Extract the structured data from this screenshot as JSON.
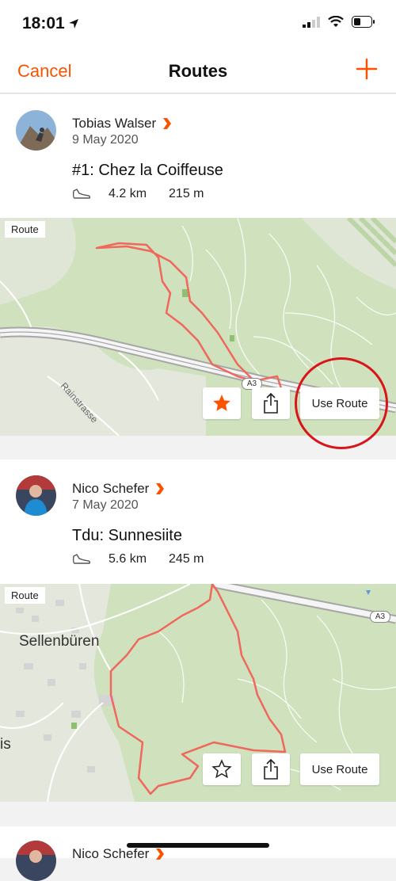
{
  "status_bar": {
    "time": "18:01"
  },
  "nav": {
    "cancel": "Cancel",
    "title": "Routes"
  },
  "routes": [
    {
      "athlete": "Tobias Walser",
      "date": "9 May 2020",
      "title": "#1: Chez la Coiffeuse",
      "distance": "4.2 km",
      "elevation": "215 m",
      "map_label": "Route",
      "street_label": "Rainstrasse",
      "highway_label": "A3",
      "starred": true,
      "use_route": "Use Route"
    },
    {
      "athlete": "Nico Schefer",
      "date": "7 May 2020",
      "title": "Tdu: Sunnesiite",
      "distance": "5.6 km",
      "elevation": "245 m",
      "map_label": "Route",
      "town_label": "Sellenbüren",
      "town_partial": "is",
      "highway_label": "A3",
      "starred": false,
      "use_route": "Use Route"
    },
    {
      "athlete": "Nico Schefer"
    }
  ],
  "colors": {
    "accent": "#fc5200",
    "route_line": "#f0675c",
    "map_green": "#cfe2bd",
    "highlight": "#d9151a"
  }
}
